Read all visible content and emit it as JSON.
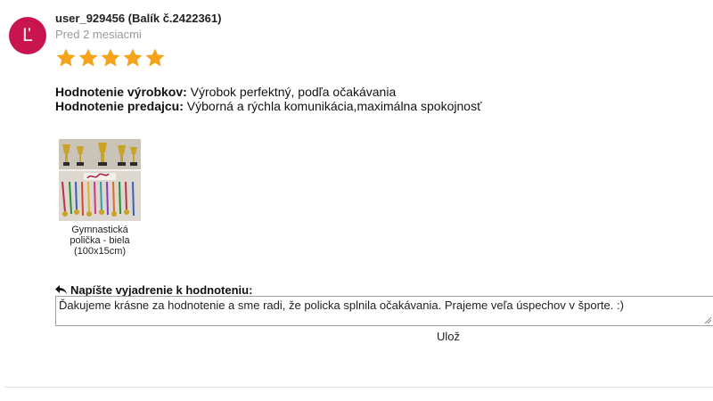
{
  "review": {
    "avatar_letter": "Ľ",
    "avatar_color": "#c9154f",
    "username": "user_929456 (Balík č.2422361)",
    "time_ago": "Pred 2 mesiacmi",
    "rating": 5,
    "rating_max": 5,
    "star_color": "#f5a31a",
    "product_rating_label": "Hodnotenie výrobkov:",
    "product_rating_text": " Výrobok perfektný, podľa očakávania",
    "seller_rating_label": "Hodnotenie predajcu:",
    "seller_rating_text": " Výborná a rýchla komunikácia,maximálna spokojnosť"
  },
  "product": {
    "image_icon": "product-thumbnail-icon",
    "caption": "Gymnastická polička - biela (100x15cm)"
  },
  "reply": {
    "label": "Napíšte vyjadrenie k hodnoteniu:",
    "icon": "reply-arrow-icon",
    "text": "Ďakujeme krásne za hodnotenie a sme radi, že policka splnila očakávania. Prajeme veľa úspechov v športe. :)",
    "save_label": "Ulož"
  }
}
